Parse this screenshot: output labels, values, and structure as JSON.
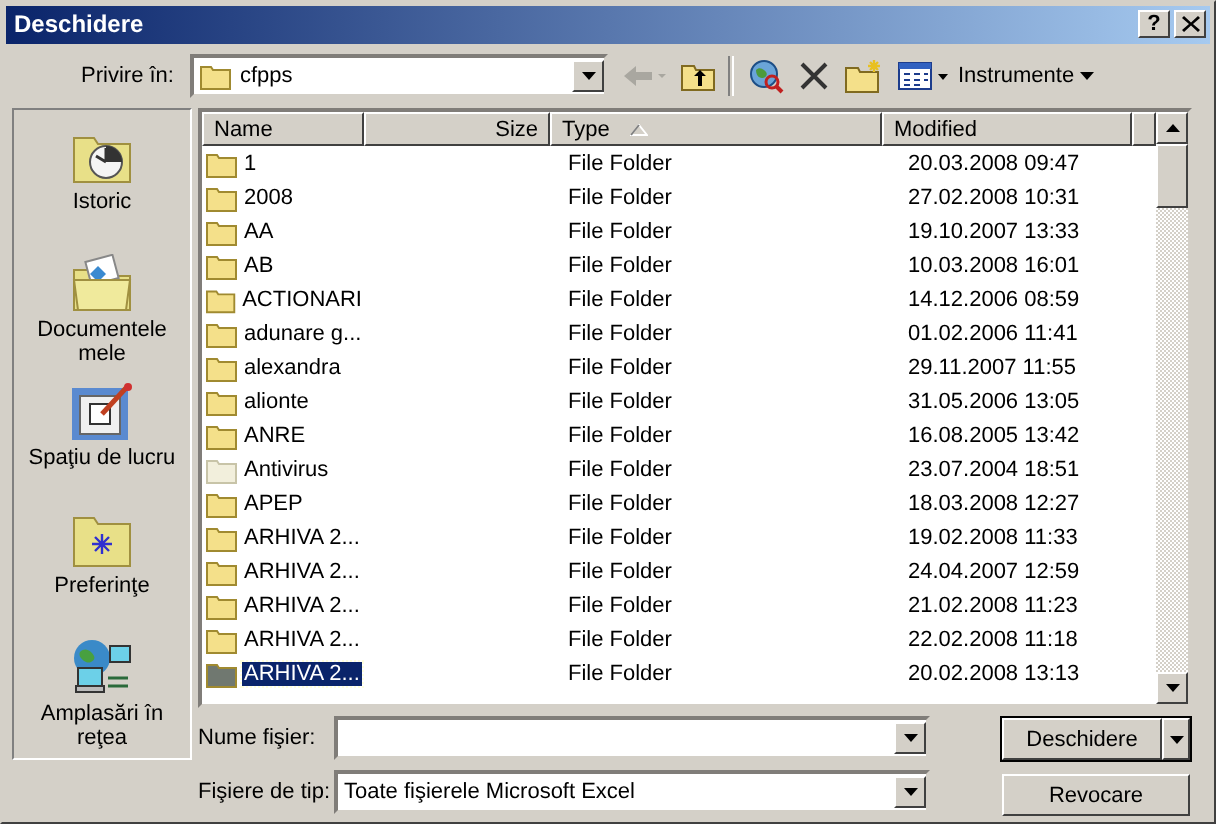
{
  "window": {
    "title": "Deschidere",
    "help": "?"
  },
  "look_in": {
    "label": "Privire în:",
    "value": "cfpps"
  },
  "toolbar": {
    "tools_label": "Instrumente"
  },
  "sidebar": {
    "items": [
      {
        "label": "Istoric",
        "kind": "history"
      },
      {
        "label": "Documentele mele",
        "kind": "documents"
      },
      {
        "label": "Spaţiu de lucru",
        "kind": "desktop"
      },
      {
        "label": "Preferinţe",
        "kind": "favorites"
      },
      {
        "label": "Amplasări în reţea",
        "kind": "network"
      }
    ]
  },
  "table": {
    "columns": [
      {
        "label": "Name",
        "sorted": false
      },
      {
        "label": "Size",
        "sorted": false
      },
      {
        "label": "Type",
        "sorted": true
      },
      {
        "label": "Modified",
        "sorted": false
      }
    ],
    "rows": [
      {
        "name": "1",
        "type": "File Folder",
        "modified": "20.03.2008 09:47",
        "hidden": false,
        "selected": false
      },
      {
        "name": "2008",
        "type": "File Folder",
        "modified": "27.02.2008 10:31",
        "hidden": false,
        "selected": false
      },
      {
        "name": "AA",
        "type": "File Folder",
        "modified": "19.10.2007 13:33",
        "hidden": false,
        "selected": false
      },
      {
        "name": "AB",
        "type": "File Folder",
        "modified": "10.03.2008 16:01",
        "hidden": false,
        "selected": false
      },
      {
        "name": "ACTIONARI",
        "type": "File Folder",
        "modified": "14.12.2006 08:59",
        "hidden": false,
        "selected": false
      },
      {
        "name": "adunare g...",
        "type": "File Folder",
        "modified": "01.02.2006 11:41",
        "hidden": false,
        "selected": false
      },
      {
        "name": "alexandra",
        "type": "File Folder",
        "modified": "29.11.2007 11:55",
        "hidden": false,
        "selected": false
      },
      {
        "name": "alionte",
        "type": "File Folder",
        "modified": "31.05.2006 13:05",
        "hidden": false,
        "selected": false
      },
      {
        "name": "ANRE",
        "type": "File Folder",
        "modified": "16.08.2005 13:42",
        "hidden": false,
        "selected": false
      },
      {
        "name": "Antivirus",
        "type": "File Folder",
        "modified": "23.07.2004 18:51",
        "hidden": true,
        "selected": false
      },
      {
        "name": "APEP",
        "type": "File Folder",
        "modified": "18.03.2008 12:27",
        "hidden": false,
        "selected": false
      },
      {
        "name": "ARHIVA 2...",
        "type": "File Folder",
        "modified": "19.02.2008 11:33",
        "hidden": false,
        "selected": false
      },
      {
        "name": "ARHIVA 2...",
        "type": "File Folder",
        "modified": "24.04.2007 12:59",
        "hidden": false,
        "selected": false
      },
      {
        "name": "ARHIVA 2...",
        "type": "File Folder",
        "modified": "21.02.2008 11:23",
        "hidden": false,
        "selected": false
      },
      {
        "name": "ARHIVA 2...",
        "type": "File Folder",
        "modified": "22.02.2008 11:18",
        "hidden": false,
        "selected": false
      },
      {
        "name": "ARHIVA 2...",
        "type": "File Folder",
        "modified": "20.02.2008 13:13",
        "hidden": false,
        "selected": true
      }
    ]
  },
  "file_name": {
    "label": "Nume fişier:"
  },
  "file_type": {
    "label": "Fişiere de tip:",
    "value": "Toate fişierele Microsoft Excel"
  },
  "buttons": [
    {
      "label": "Deschidere",
      "default": true,
      "split": true
    },
    {
      "label": "Revocare",
      "default": false,
      "split": false
    }
  ]
}
